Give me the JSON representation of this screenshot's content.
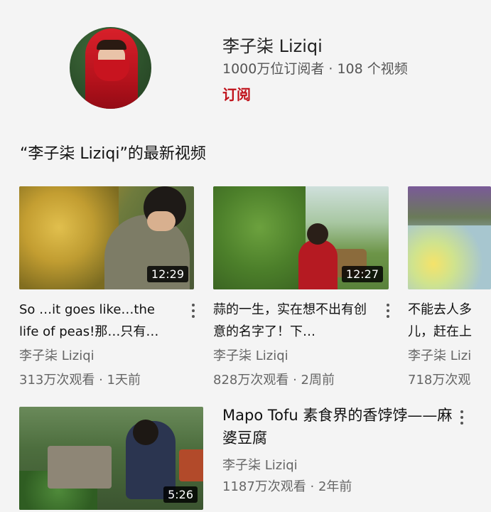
{
  "channel": {
    "name": "李子柒 Liziqi",
    "meta": "1000万位订阅者 · 108 个视频",
    "subscribe_label": "订阅"
  },
  "section": {
    "title": "“李子柒 Liziqi”的最新视频"
  },
  "videos": [
    {
      "title": "So …it goes like…the life of peas!那…只有…",
      "channel": "李子柒 Liziqi",
      "stats": "313万次观看 · 1天前",
      "duration": "12:29"
    },
    {
      "title": "蒜的一生，实在想不出有创意的名字了！下…",
      "channel": "李子柒 Liziqi",
      "stats": "828万次观看 · 2周前",
      "duration": "12:27"
    },
    {
      "title": "不能去人多儿，赶在上",
      "channel": "李子柒 Lizi",
      "stats": "718万次观",
      "duration": ""
    },
    {
      "title": "Mapo Tofu 素食界的香饽饽——麻婆豆腐",
      "channel": "李子柒 Liziqi",
      "stats": "1187万次观看 · 2年前",
      "duration": "5:26"
    }
  ]
}
